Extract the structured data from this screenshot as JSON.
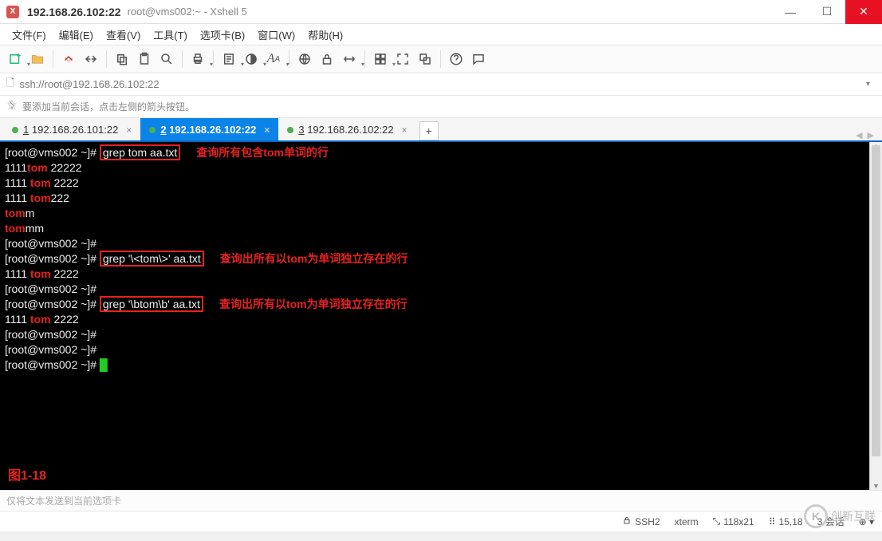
{
  "window": {
    "title_host": "192.168.26.102:22",
    "title_rest": "root@vms002:~ - Xshell 5"
  },
  "menu": {
    "file": "文件(F)",
    "edit": "编辑(E)",
    "view": "查看(V)",
    "tools": "工具(T)",
    "tabs": "选项卡(B)",
    "window": "窗口(W)",
    "help": "帮助(H)"
  },
  "address": {
    "url": "ssh://root@192.168.26.102:22"
  },
  "hint": {
    "text": "要添加当前会话，点击左侧的箭头按钮。"
  },
  "tabs": [
    {
      "num": "1",
      "label": "192.168.26.101:22",
      "active": false
    },
    {
      "num": "2",
      "label": "192.168.26.102:22",
      "active": true
    },
    {
      "num": "3",
      "label": "192.168.26.102:22",
      "active": false
    }
  ],
  "terminal": {
    "figure_label": "图1-18",
    "lines": [
      {
        "prompt": "[root@vms002 ~]# ",
        "boxed": "grep tom aa.txt",
        "note": "查询所有包含tom单词的行"
      },
      {
        "pre": "1111",
        "red": "tom",
        "post": " 22222"
      },
      {
        "pre": "1111 ",
        "red": "tom",
        "post": " 2222"
      },
      {
        "pre": "1111 ",
        "red": "tom",
        "post": "222"
      },
      {
        "pre": "",
        "red": "tom",
        "post": "m"
      },
      {
        "pre": "",
        "red": "tom",
        "post": "mm"
      },
      {
        "prompt": "[root@vms002 ~]#"
      },
      {
        "prompt": "[root@vms002 ~]# ",
        "boxed": "grep '\\<tom\\>' aa.txt",
        "note": "查询出所有以tom为单词独立存在的行"
      },
      {
        "pre": "1111 ",
        "red": "tom",
        "post": " 2222"
      },
      {
        "prompt": "[root@vms002 ~]#"
      },
      {
        "prompt": "[root@vms002 ~]# ",
        "boxed": "grep '\\btom\\b' aa.txt",
        "note": "查询出所有以tom为单词独立存在的行"
      },
      {
        "pre": "1111 ",
        "red": "tom",
        "post": " 2222"
      },
      {
        "prompt": "[root@vms002 ~]#"
      },
      {
        "prompt": "[root@vms002 ~]#"
      },
      {
        "prompt": "[root@vms002 ~]# ",
        "cursor": true
      }
    ]
  },
  "sendbar": {
    "text": "仅将文本发送到当前选项卡"
  },
  "status": {
    "proto": "SSH2",
    "term": "xterm",
    "size": "118x21",
    "cursor": "15,18",
    "sessions": "3 会話",
    "sessions_cn": "3 会话"
  },
  "watermark": {
    "letter": "K",
    "text": "创新互联"
  }
}
